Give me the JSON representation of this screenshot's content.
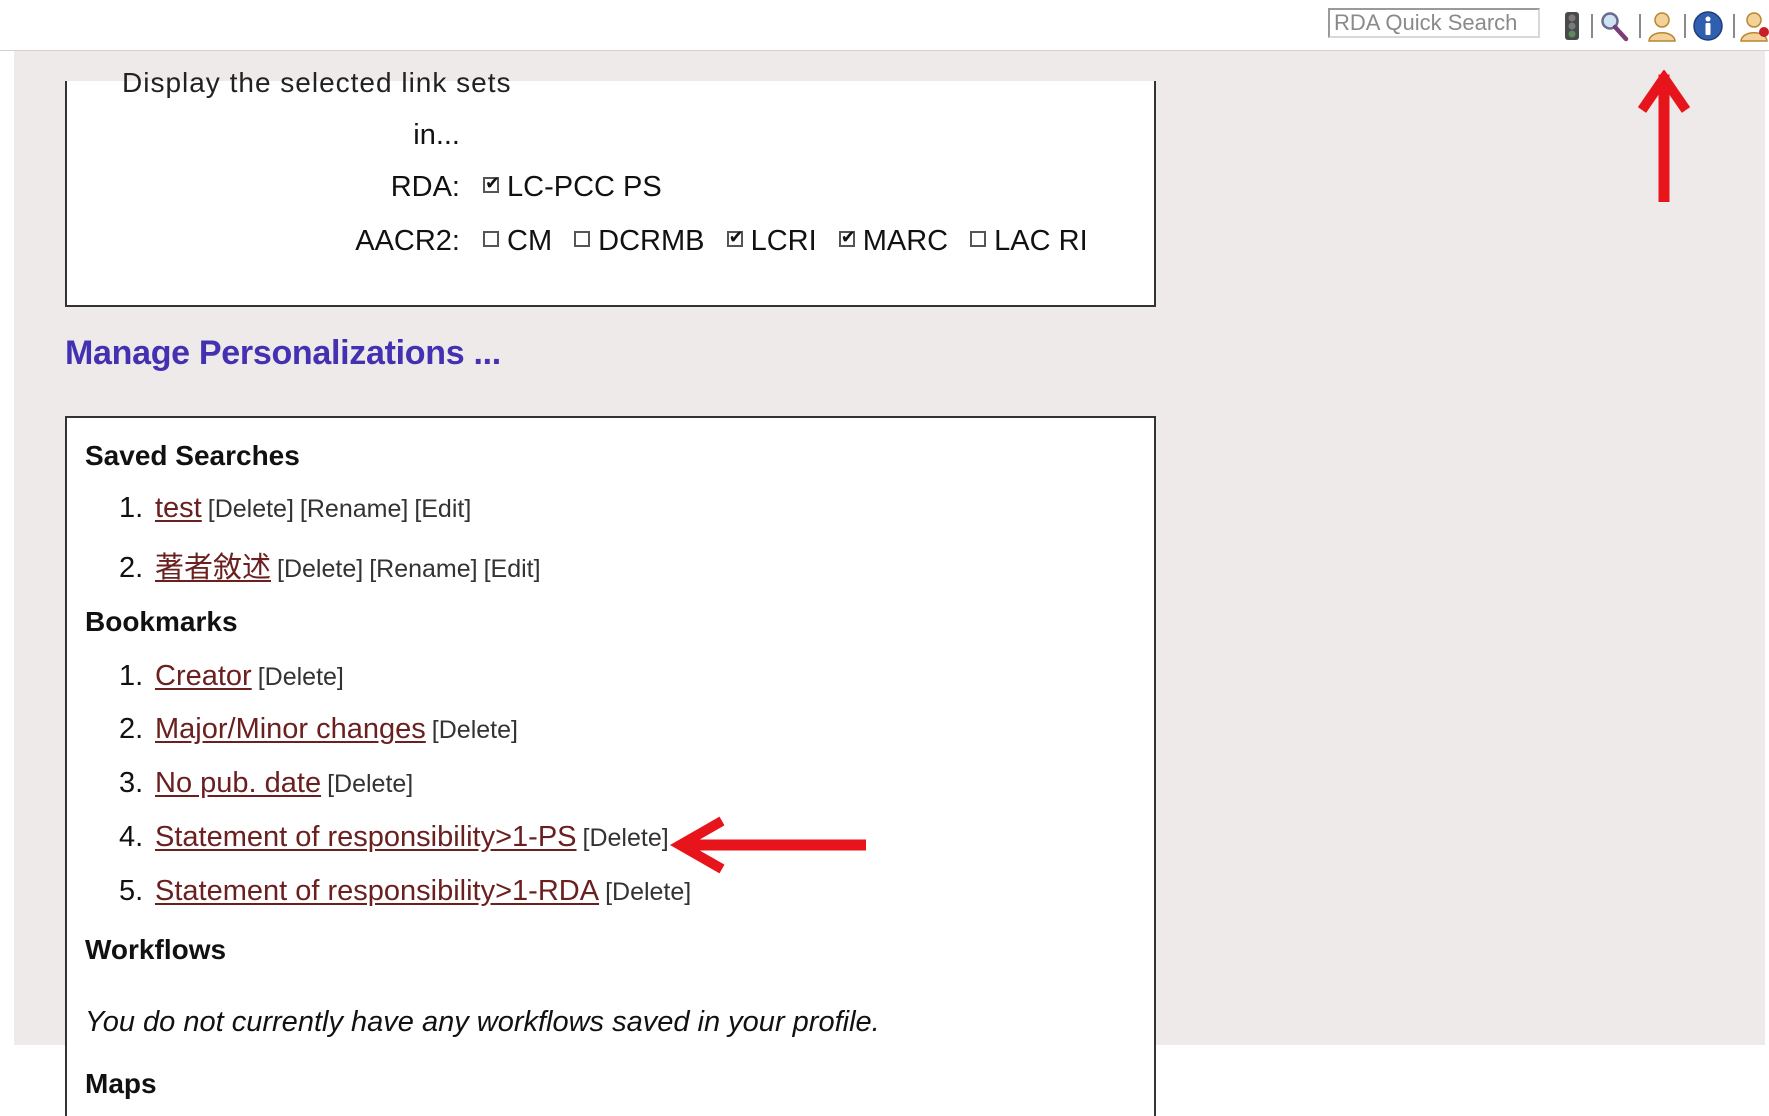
{
  "toolbar": {
    "search_placeholder": "RDA Quick Search",
    "icons": [
      "traffic-light-icon",
      "magnifier-icon",
      "user-profile-icon",
      "info-icon",
      "user-bookmark-icon"
    ]
  },
  "display_options": {
    "cut_line": "Display the selected link sets",
    "in_label": "in...",
    "rda_label": "RDA:",
    "rda_options": [
      {
        "label": "LC-PCC PS",
        "checked": true
      }
    ],
    "aacr2_label": "AACR2:",
    "aacr2_options": [
      {
        "label": "CM",
        "checked": false
      },
      {
        "label": "DCRMB",
        "checked": false
      },
      {
        "label": "LCRI",
        "checked": true
      },
      {
        "label": "MARC",
        "checked": true
      },
      {
        "label": "LAC RI",
        "checked": false
      }
    ]
  },
  "manage_heading": "Manage Personalizations ...",
  "saved_searches": {
    "title": "Saved Searches",
    "items": [
      {
        "num": "1.",
        "name": "test",
        "actions": [
          "[Delete]",
          "[Rename]",
          "[Edit]"
        ]
      },
      {
        "num": "2.",
        "name": "著者敘述",
        "actions": [
          "[Delete]",
          "[Rename]",
          "[Edit]"
        ]
      }
    ]
  },
  "bookmarks": {
    "title": "Bookmarks",
    "items": [
      {
        "num": "1.",
        "name": "Creator",
        "action": "[Delete]"
      },
      {
        "num": "2.",
        "name": "Major/Minor changes",
        "action": "[Delete]"
      },
      {
        "num": "3.",
        "name": "No pub. date",
        "action": "[Delete]"
      },
      {
        "num": "4.",
        "name": "Statement of responsibility>1-PS",
        "action": "[Delete]"
      },
      {
        "num": "5.",
        "name": "Statement of responsibility>1-RDA",
        "action": "[Delete]"
      }
    ]
  },
  "workflows": {
    "title": "Workflows",
    "empty_message": "You do not currently have any workflows saved in your profile."
  },
  "maps": {
    "title": "Maps"
  },
  "colors": {
    "heading": "#4431b2",
    "link": "#6b2020",
    "annotation": "#e8141b",
    "page_bg": "#eeeaea"
  }
}
